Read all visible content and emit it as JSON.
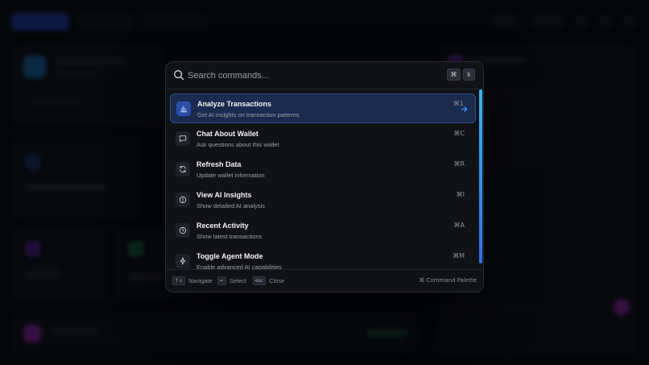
{
  "search": {
    "placeholder": "Search commands...",
    "shortcut_mod": "⌘",
    "shortcut_key": "k"
  },
  "commands": [
    {
      "title": "Analyze Transactions",
      "description": "Get AI insights on transaction patterns",
      "shortcut": "⌘1",
      "icon": "bar-chart-icon",
      "selected": true
    },
    {
      "title": "Chat About Wallet",
      "description": "Ask questions about this wallet",
      "shortcut": "⌘C",
      "icon": "message-icon",
      "selected": false
    },
    {
      "title": "Refresh Data",
      "description": "Update wallet information",
      "shortcut": "⌘R",
      "icon": "refresh-icon",
      "selected": false
    },
    {
      "title": "View AI Insights",
      "description": "Show detailed AI analysis",
      "shortcut": "⌘I",
      "icon": "insight-icon",
      "selected": false
    },
    {
      "title": "Recent Activity",
      "description": "Show latest transactions",
      "shortcut": "⌘A",
      "icon": "clock-icon",
      "selected": false
    },
    {
      "title": "Toggle Agent Mode",
      "description": "Enable advanced AI capabilities",
      "shortcut": "⌘M",
      "icon": "lightning-icon",
      "selected": false
    }
  ],
  "footer": {
    "navigate_key": "↑↓",
    "navigate_label": "Navigate",
    "select_key": "↵",
    "select_label": "Select",
    "close_key": "esc",
    "close_label": "Close",
    "palette_label": "⌘ Command Palette"
  },
  "colors": {
    "accent": "#2f6fe8",
    "selected_bg": "#1a2b4d",
    "scrollbar": "#3bb4f6"
  }
}
